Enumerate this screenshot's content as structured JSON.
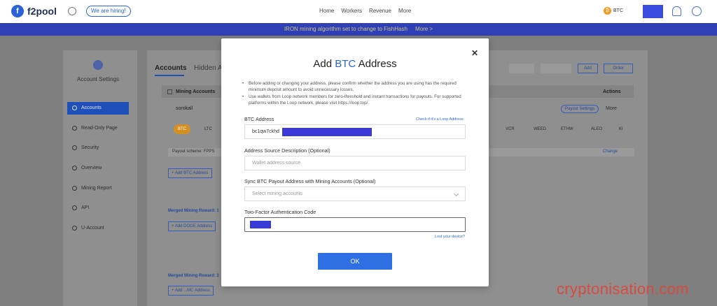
{
  "app": {
    "logo_text": "f2pool",
    "logo_mark": "f",
    "hiring_badge": "We are hiring!"
  },
  "nav": {
    "items": [
      "Home",
      "Workers",
      "Revenue",
      "More"
    ]
  },
  "header": {
    "coin_label": "BTC",
    "coin_icon": "bitcoin-icon",
    "coin_symbol": "₿"
  },
  "banner": {
    "text": "IRON mining algorithm set to change to FishHash",
    "more": "More >",
    "color": "#2f3fb5"
  },
  "sidebar": {
    "title": "Account Settings",
    "items": [
      {
        "label": "Accounts",
        "active": true
      },
      {
        "label": "Read-Only Page"
      },
      {
        "label": "Security"
      },
      {
        "label": "Overview"
      },
      {
        "label": "Mining Report"
      },
      {
        "label": "API"
      },
      {
        "label": "U-Account"
      }
    ]
  },
  "main": {
    "tabs": [
      "Accounts",
      "Hidden A"
    ],
    "top_buttons": [
      "Add",
      "Order"
    ],
    "table_headers": {
      "first": "Mining Accounts",
      "last": "Actions"
    },
    "row": {
      "name": "sorokall",
      "payout_settings": "Payout Settings",
      "more": "More"
    },
    "coins": [
      "BTC",
      "LTC",
      "VCR",
      "WEED",
      "ETHW",
      "ALEO",
      "Ki"
    ],
    "payout_scheme": "Payout scheme: FPPS",
    "change_label": "Change",
    "add_btc_button": "+ Add BTC Address",
    "merged_1": "Merged Mining Reward: 1",
    "add_dog_button": "+ Add DOGE Address",
    "merged_2": "Merged Mining Reward: 2",
    "add_next_button": "+ Add ...MC Address"
  },
  "modal": {
    "title_prefix": "Add",
    "title_coin": "BTC",
    "title_suffix": "Address",
    "notes": [
      "Before adding or changing your address, please confirm whether the address you are using has the required minimum deposit amount to avoid unnecessary losses.",
      "Use wallets from Loop network members for zero-threshold and instant transactions for payouts. For supported platforms within the Loop network, please visit https://loop.top/."
    ],
    "btc_address": {
      "label": "BTC Address",
      "link": "Check if it's a Loop Address",
      "value": "bc1qw7ckhd"
    },
    "source_description": {
      "label": "Address Source Description (Optional)",
      "placeholder": "Wallet address source"
    },
    "sync": {
      "label": "Sync BTC Payout Address with Mining Accounts (Optional)",
      "placeholder": "Select mining accounts"
    },
    "two_factor": {
      "label": "Two-Factor Authentication Code",
      "lost_link": "Lost your device?"
    },
    "ok_label": "OK",
    "accent_color": "#2f6fe4"
  },
  "watermark": "cryptonisation.com"
}
